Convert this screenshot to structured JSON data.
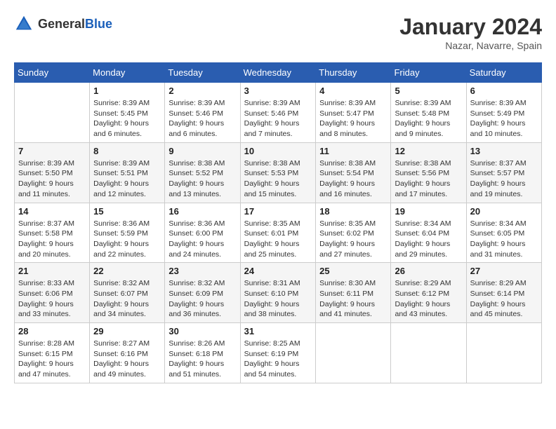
{
  "logo": {
    "text_general": "General",
    "text_blue": "Blue"
  },
  "title": {
    "month_year": "January 2024",
    "location": "Nazar, Navarre, Spain"
  },
  "weekdays": [
    "Sunday",
    "Monday",
    "Tuesday",
    "Wednesday",
    "Thursday",
    "Friday",
    "Saturday"
  ],
  "weeks": [
    [
      {
        "day": "",
        "sunrise": "",
        "sunset": "",
        "daylight": ""
      },
      {
        "day": "1",
        "sunrise": "Sunrise: 8:39 AM",
        "sunset": "Sunset: 5:45 PM",
        "daylight": "Daylight: 9 hours and 6 minutes."
      },
      {
        "day": "2",
        "sunrise": "Sunrise: 8:39 AM",
        "sunset": "Sunset: 5:46 PM",
        "daylight": "Daylight: 9 hours and 6 minutes."
      },
      {
        "day": "3",
        "sunrise": "Sunrise: 8:39 AM",
        "sunset": "Sunset: 5:46 PM",
        "daylight": "Daylight: 9 hours and 7 minutes."
      },
      {
        "day": "4",
        "sunrise": "Sunrise: 8:39 AM",
        "sunset": "Sunset: 5:47 PM",
        "daylight": "Daylight: 9 hours and 8 minutes."
      },
      {
        "day": "5",
        "sunrise": "Sunrise: 8:39 AM",
        "sunset": "Sunset: 5:48 PM",
        "daylight": "Daylight: 9 hours and 9 minutes."
      },
      {
        "day": "6",
        "sunrise": "Sunrise: 8:39 AM",
        "sunset": "Sunset: 5:49 PM",
        "daylight": "Daylight: 9 hours and 10 minutes."
      }
    ],
    [
      {
        "day": "7",
        "sunrise": "Sunrise: 8:39 AM",
        "sunset": "Sunset: 5:50 PM",
        "daylight": "Daylight: 9 hours and 11 minutes."
      },
      {
        "day": "8",
        "sunrise": "Sunrise: 8:39 AM",
        "sunset": "Sunset: 5:51 PM",
        "daylight": "Daylight: 9 hours and 12 minutes."
      },
      {
        "day": "9",
        "sunrise": "Sunrise: 8:38 AM",
        "sunset": "Sunset: 5:52 PM",
        "daylight": "Daylight: 9 hours and 13 minutes."
      },
      {
        "day": "10",
        "sunrise": "Sunrise: 8:38 AM",
        "sunset": "Sunset: 5:53 PM",
        "daylight": "Daylight: 9 hours and 15 minutes."
      },
      {
        "day": "11",
        "sunrise": "Sunrise: 8:38 AM",
        "sunset": "Sunset: 5:54 PM",
        "daylight": "Daylight: 9 hours and 16 minutes."
      },
      {
        "day": "12",
        "sunrise": "Sunrise: 8:38 AM",
        "sunset": "Sunset: 5:56 PM",
        "daylight": "Daylight: 9 hours and 17 minutes."
      },
      {
        "day": "13",
        "sunrise": "Sunrise: 8:37 AM",
        "sunset": "Sunset: 5:57 PM",
        "daylight": "Daylight: 9 hours and 19 minutes."
      }
    ],
    [
      {
        "day": "14",
        "sunrise": "Sunrise: 8:37 AM",
        "sunset": "Sunset: 5:58 PM",
        "daylight": "Daylight: 9 hours and 20 minutes."
      },
      {
        "day": "15",
        "sunrise": "Sunrise: 8:36 AM",
        "sunset": "Sunset: 5:59 PM",
        "daylight": "Daylight: 9 hours and 22 minutes."
      },
      {
        "day": "16",
        "sunrise": "Sunrise: 8:36 AM",
        "sunset": "Sunset: 6:00 PM",
        "daylight": "Daylight: 9 hours and 24 minutes."
      },
      {
        "day": "17",
        "sunrise": "Sunrise: 8:35 AM",
        "sunset": "Sunset: 6:01 PM",
        "daylight": "Daylight: 9 hours and 25 minutes."
      },
      {
        "day": "18",
        "sunrise": "Sunrise: 8:35 AM",
        "sunset": "Sunset: 6:02 PM",
        "daylight": "Daylight: 9 hours and 27 minutes."
      },
      {
        "day": "19",
        "sunrise": "Sunrise: 8:34 AM",
        "sunset": "Sunset: 6:04 PM",
        "daylight": "Daylight: 9 hours and 29 minutes."
      },
      {
        "day": "20",
        "sunrise": "Sunrise: 8:34 AM",
        "sunset": "Sunset: 6:05 PM",
        "daylight": "Daylight: 9 hours and 31 minutes."
      }
    ],
    [
      {
        "day": "21",
        "sunrise": "Sunrise: 8:33 AM",
        "sunset": "Sunset: 6:06 PM",
        "daylight": "Daylight: 9 hours and 33 minutes."
      },
      {
        "day": "22",
        "sunrise": "Sunrise: 8:32 AM",
        "sunset": "Sunset: 6:07 PM",
        "daylight": "Daylight: 9 hours and 34 minutes."
      },
      {
        "day": "23",
        "sunrise": "Sunrise: 8:32 AM",
        "sunset": "Sunset: 6:09 PM",
        "daylight": "Daylight: 9 hours and 36 minutes."
      },
      {
        "day": "24",
        "sunrise": "Sunrise: 8:31 AM",
        "sunset": "Sunset: 6:10 PM",
        "daylight": "Daylight: 9 hours and 38 minutes."
      },
      {
        "day": "25",
        "sunrise": "Sunrise: 8:30 AM",
        "sunset": "Sunset: 6:11 PM",
        "daylight": "Daylight: 9 hours and 41 minutes."
      },
      {
        "day": "26",
        "sunrise": "Sunrise: 8:29 AM",
        "sunset": "Sunset: 6:12 PM",
        "daylight": "Daylight: 9 hours and 43 minutes."
      },
      {
        "day": "27",
        "sunrise": "Sunrise: 8:29 AM",
        "sunset": "Sunset: 6:14 PM",
        "daylight": "Daylight: 9 hours and 45 minutes."
      }
    ],
    [
      {
        "day": "28",
        "sunrise": "Sunrise: 8:28 AM",
        "sunset": "Sunset: 6:15 PM",
        "daylight": "Daylight: 9 hours and 47 minutes."
      },
      {
        "day": "29",
        "sunrise": "Sunrise: 8:27 AM",
        "sunset": "Sunset: 6:16 PM",
        "daylight": "Daylight: 9 hours and 49 minutes."
      },
      {
        "day": "30",
        "sunrise": "Sunrise: 8:26 AM",
        "sunset": "Sunset: 6:18 PM",
        "daylight": "Daylight: 9 hours and 51 minutes."
      },
      {
        "day": "31",
        "sunrise": "Sunrise: 8:25 AM",
        "sunset": "Sunset: 6:19 PM",
        "daylight": "Daylight: 9 hours and 54 minutes."
      },
      {
        "day": "",
        "sunrise": "",
        "sunset": "",
        "daylight": ""
      },
      {
        "day": "",
        "sunrise": "",
        "sunset": "",
        "daylight": ""
      },
      {
        "day": "",
        "sunrise": "",
        "sunset": "",
        "daylight": ""
      }
    ]
  ]
}
